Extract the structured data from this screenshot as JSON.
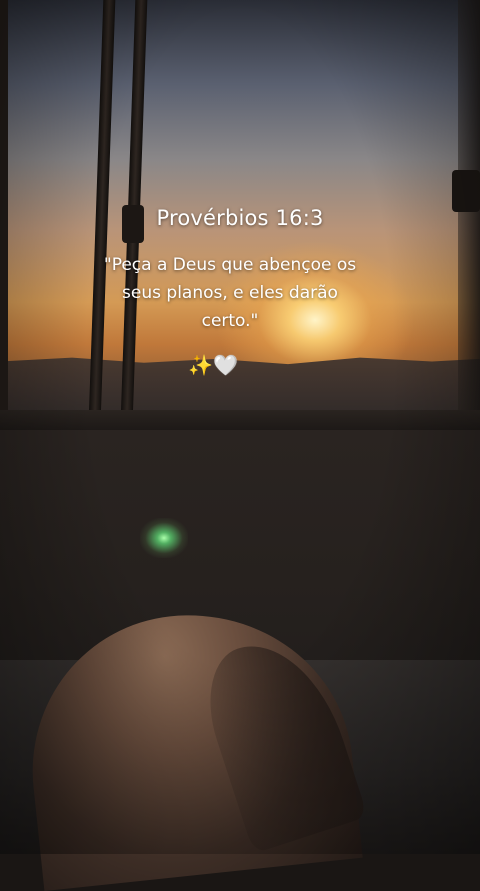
{
  "overlay": {
    "reference": "Provérbios 16:3",
    "quote": "\"Peça a Deus que abençoe os\nseus planos, e eles darão\ncerto.\"",
    "emoji_sparkles": "✨",
    "emoji_heart": "🤍"
  },
  "scene": {
    "description_icons": [
      "sparkles-icon",
      "white-heart-icon"
    ]
  }
}
